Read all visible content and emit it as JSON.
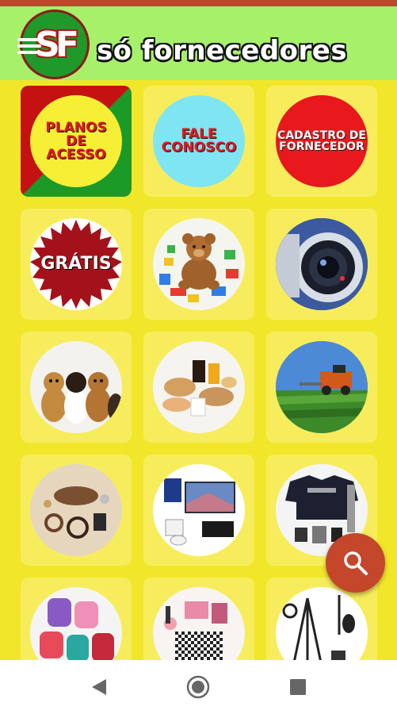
{
  "header": {
    "logo_text": "SF",
    "title": "só fornecedores",
    "menu_icon": "hamburger-menu-icon"
  },
  "tiles": [
    {
      "name": "planos-de-acesso",
      "label": "PLANOS DE ACESSO"
    },
    {
      "name": "fale-conosco",
      "label": "FALE CONOSCO"
    },
    {
      "name": "cadastro-de-fornecedor",
      "label": "CADASTRO DE FORNECEDOR"
    },
    {
      "name": "gratis",
      "label": "GRÁTIS"
    },
    {
      "name": "toys",
      "label": ""
    },
    {
      "name": "security-camera",
      "label": ""
    },
    {
      "name": "pets",
      "label": ""
    },
    {
      "name": "food",
      "label": ""
    },
    {
      "name": "agriculture",
      "label": ""
    },
    {
      "name": "accessories",
      "label": ""
    },
    {
      "name": "electronics",
      "label": ""
    },
    {
      "name": "clothing",
      "label": ""
    },
    {
      "name": "backpacks",
      "label": ""
    },
    {
      "name": "cosmetics",
      "label": ""
    },
    {
      "name": "photo-equipment",
      "label": ""
    }
  ],
  "fab": {
    "icon": "search-icon"
  },
  "navigation": {
    "back_icon": "back-triangle-icon",
    "home_icon": "home-circle-icon",
    "recents_icon": "recents-square-icon"
  },
  "colors": {
    "background": "#f2e62a",
    "header": "#a6f06a",
    "fab": "#c4472b"
  }
}
